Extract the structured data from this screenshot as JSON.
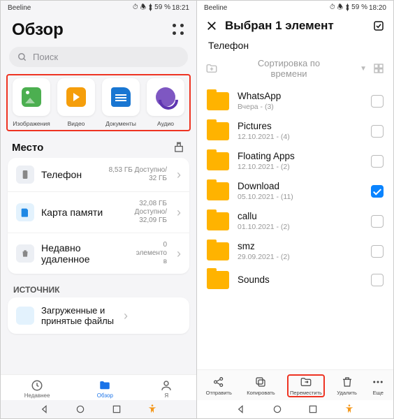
{
  "left": {
    "status": {
      "carrier": "Beeline",
      "battery": "⏱ 🕭 ⬍ 59 %",
      "time": "18:21"
    },
    "title": "Обзор",
    "search_placeholder": "Поиск",
    "categories": [
      {
        "label": "Изображения"
      },
      {
        "label": "Видео"
      },
      {
        "label": "Документы"
      },
      {
        "label": "Аудио"
      }
    ],
    "place_section": "Место",
    "places": [
      {
        "label": "Телефон",
        "sub": "8,53 ГБ Доступно/\n32 ГБ"
      },
      {
        "label": "Карта памяти",
        "sub": "32,08 ГБ\nДоступно/\n32,09 ГБ"
      },
      {
        "label": "Недавно удаленное",
        "sub": "0\nэлементо\nв"
      }
    ],
    "source_section": "ИСТОЧНИК",
    "source_item": "Загруженные и\nпринятые файлы",
    "nav": {
      "recent": "Недавнее",
      "overview": "Обзор",
      "me": "Я"
    }
  },
  "right": {
    "status": {
      "carrier": "Beeline",
      "battery": "⏱ 🕭 ⬍ 59 %",
      "time": "18:20"
    },
    "sel_title": "Выбран 1 элемент",
    "breadcrumb": "Телефон",
    "sort_label": "Сортировка по\nвремени",
    "folders": [
      {
        "name": "WhatsApp",
        "sub": "Вчера - (3)",
        "checked": false
      },
      {
        "name": "Pictures",
        "sub": "12.10.2021 - (4)",
        "checked": false
      },
      {
        "name": "Floating Apps",
        "sub": "12.10.2021 - (2)",
        "checked": false
      },
      {
        "name": "Download",
        "sub": "05.10.2021 - (11)",
        "checked": true
      },
      {
        "name": "callu",
        "sub": "01.10.2021 - (2)",
        "checked": false
      },
      {
        "name": "smz",
        "sub": "29.09.2021 - (2)",
        "checked": false
      },
      {
        "name": "Sounds",
        "sub": "",
        "checked": false
      }
    ],
    "actions": {
      "send": "Отправить",
      "copy": "Копировать",
      "move": "Переместить",
      "delete": "Удалить",
      "more": "Еще"
    }
  }
}
